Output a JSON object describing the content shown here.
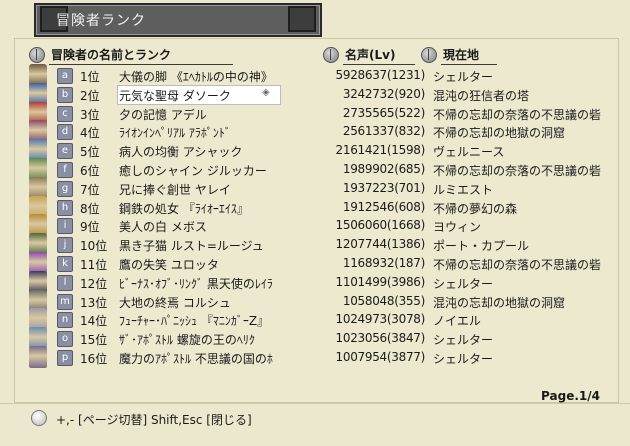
{
  "window": {
    "title": "冒険者ランク"
  },
  "headers": {
    "name_rank": "冒険者の名前とランク",
    "fame": "名声(Lv)",
    "location": "現在地"
  },
  "rows": [
    {
      "letter": "a",
      "rank": "1位",
      "name": "大儀の脚 《ｴﾍｶﾄﾙの中の神》",
      "fame": "5928637(1231)",
      "location": "シェルター",
      "avatar_color": "#6a5a3a"
    },
    {
      "letter": "b",
      "rank": "2位",
      "name": "元気な聖母 ダソーク",
      "fame": "3242732(920)",
      "location": "混沌の狂信者の塔",
      "avatar_color": "#3c5fa8",
      "selected": true
    },
    {
      "letter": "c",
      "rank": "3位",
      "name": "夕の記憶 アデル",
      "fame": "2735565(522)",
      "location": "不帰の忘却の奈落の不思議の砦",
      "avatar_color": "#b33b2e"
    },
    {
      "letter": "d",
      "rank": "4位",
      "name": "ﾗｲｵﾝｲﾝﾍﾟﾘｱﾙ ｱﾗﾎﾟﾝﾄﾞ",
      "fame": "2561337(832)",
      "location": "不帰の忘却の地獄の洞窟",
      "avatar_color": "#8a4a6a"
    },
    {
      "letter": "e",
      "rank": "5位",
      "name": "病人の均衡 アシャック",
      "fame": "2161421(1598)",
      "location": "ヴェルニース",
      "avatar_color": "#4a7ab0"
    },
    {
      "letter": "f",
      "rank": "6位",
      "name": "癒しのシャイン ジルッカー",
      "fame": "1989902(685)",
      "location": "不帰の忘却の奈落の不思議の砦",
      "avatar_color": "#5a8a4a"
    },
    {
      "letter": "g",
      "rank": "7位",
      "name": "兄に捧ぐ創世 ヤレイ",
      "fame": "1937223(701)",
      "location": "ルミエスト",
      "avatar_color": "#8a7a5a"
    },
    {
      "letter": "h",
      "rank": "8位",
      "name": "鋼鉄の処女 『ﾗｲｵｰｴｲｽ』",
      "fame": "1912546(608)",
      "location": "不帰の夢幻の森",
      "avatar_color": "#c9a64a"
    },
    {
      "letter": "i",
      "rank": "9位",
      "name": "美人の白 メボス",
      "fame": "1506060(1668)",
      "location": "ヨウィン",
      "avatar_color": "#b88a3a"
    },
    {
      "letter": "j",
      "rank": "10位",
      "name": "黒き子猫 ルスト=ルージュ",
      "fame": "1207744(1386)",
      "location": "ポート・カプール",
      "avatar_color": "#4a6a3a"
    },
    {
      "letter": "k",
      "rank": "11位",
      "name": "鷹の失笑 ユロッタ",
      "fame": "1168932(187)",
      "location": "不帰の忘却の奈落の不思議の砦",
      "avatar_color": "#8a4ab0"
    },
    {
      "letter": "l",
      "rank": "12位",
      "name": "ﾋﾞｰﾅｽ･ｵﾌﾞ･ﾘﾝｸﾞ 黒天使のﾚｲﾗ",
      "fame": "1101499(3986)",
      "location": "シェルター",
      "avatar_color": "#3a3a5a"
    },
    {
      "letter": "m",
      "rank": "13位",
      "name": "大地の終焉 コルシュ",
      "fame": "1058048(355)",
      "location": "混沌の忘却の地獄の洞窟",
      "avatar_color": "#6a6a6a"
    },
    {
      "letter": "n",
      "rank": "14位",
      "name": "ﾌｭｰﾁｬｰ･ﾊﾟﾆｯｼｭ 『ﾏﾆﾝｶﾞｰZ』",
      "fame": "1024973(3078)",
      "location": "ノイエル",
      "avatar_color": "#9a9aa8"
    },
    {
      "letter": "o",
      "rank": "15位",
      "name": "ｻﾞ･ｱﾎﾟｽﾄﾙ 螺旋の王のﾍﾘｸ",
      "fame": "1023056(3847)",
      "location": "シェルター",
      "avatar_color": "#6a8ab8"
    },
    {
      "letter": "p",
      "rank": "16位",
      "name": "魔力のｱﾎﾟｽﾄﾙ 不思議の国のﾎ",
      "fame": "1007954(3877)",
      "location": "シェルター",
      "avatar_color": "#7a6a8a"
    }
  ],
  "pagination": {
    "label": "Page.1/4"
  },
  "footer": {
    "hint": "+,- [ページ切替]  Shift,Esc [閉じる]"
  }
}
